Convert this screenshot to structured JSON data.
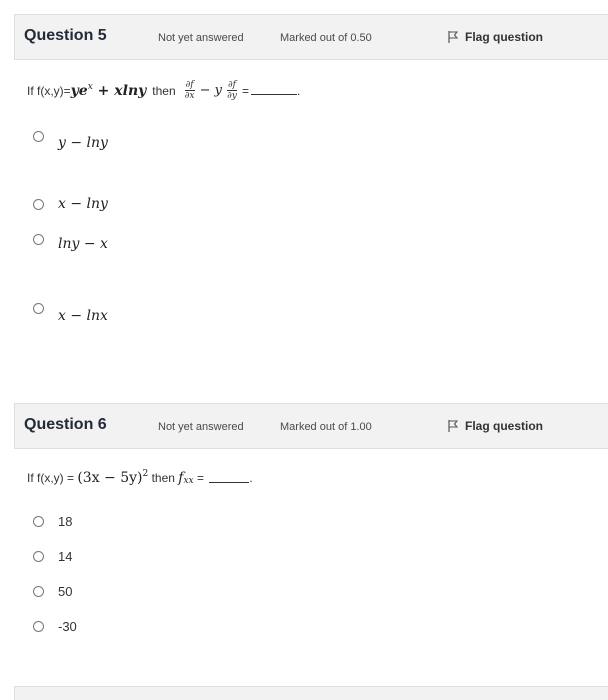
{
  "q5": {
    "title": "Question 5",
    "state": "Not yet answered",
    "mark": "Marked out of 0.50",
    "flag_label": "Flag question",
    "prefix": "If f(x,y)= ",
    "expr_main": "ye",
    "expr_sup": "x",
    "expr_rest": " + xlny",
    "then": "then",
    "frac1_num": "∂f",
    "frac1_den": "∂x",
    "minus_y": "− y",
    "frac2_num": "∂f",
    "frac2_den": "∂y",
    "eq": "=",
    "end": ".",
    "options": [
      "y − lny",
      "x − lny",
      "lny − x",
      "x − lnx"
    ]
  },
  "q6": {
    "title": "Question 6",
    "state": "Not yet answered",
    "mark": "Marked out of 1.00",
    "flag_label": "Flag question",
    "prefix": "If f(x,y) = ",
    "expr": "(3x − 5y)",
    "expr_sup": "2",
    "then": " then ",
    "f_sym": "f",
    "f_sub": "xx",
    "eq": " = ",
    "end": ".",
    "options": [
      "18",
      "14",
      "50",
      "-30"
    ]
  }
}
